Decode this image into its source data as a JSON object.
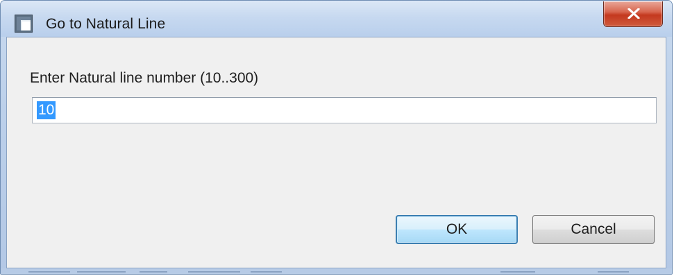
{
  "window": {
    "title": "Go to Natural Line",
    "app_icon": "dialog-app-icon",
    "close_icon": "close-icon"
  },
  "dialog": {
    "prompt": "Enter Natural line number (10..300)",
    "line_number_value": "10"
  },
  "buttons": {
    "ok_label": "OK",
    "cancel_label": "Cancel"
  },
  "colors": {
    "selection": "#3399ff",
    "close_button": "#c4391f",
    "default_button_border": "#3c7fb1",
    "client_background": "#f0f0f0"
  }
}
